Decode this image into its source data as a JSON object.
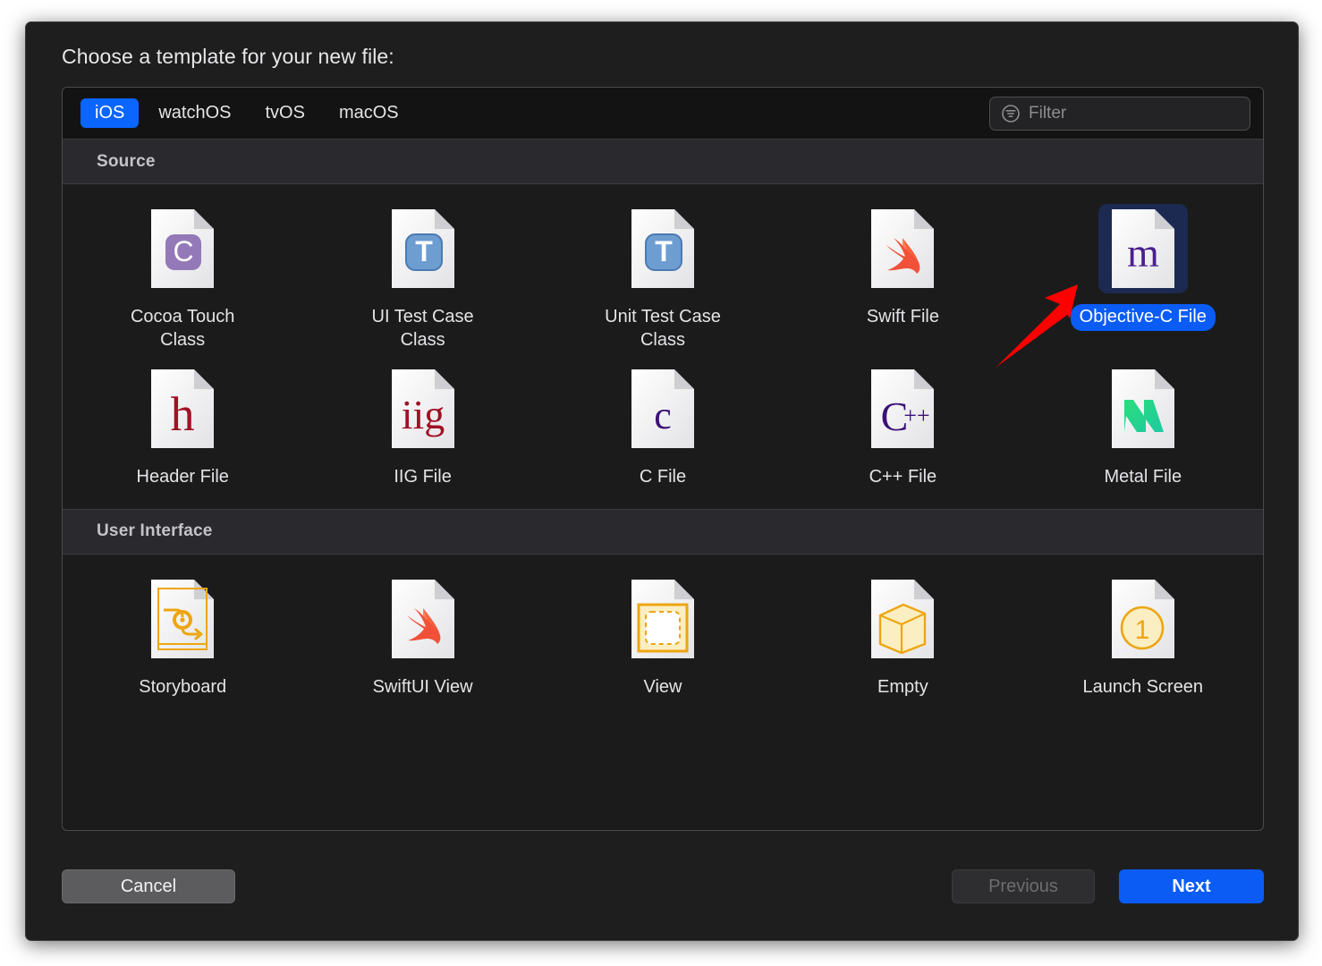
{
  "dialog": {
    "title": "Choose a template for your new file:"
  },
  "tabs": [
    {
      "label": "iOS",
      "active": true
    },
    {
      "label": "watchOS",
      "active": false
    },
    {
      "label": "tvOS",
      "active": false
    },
    {
      "label": "macOS",
      "active": false
    }
  ],
  "filter": {
    "placeholder": "Filter",
    "value": "",
    "icon": "filter-icon"
  },
  "sections": [
    {
      "header": "Source",
      "items": [
        {
          "label": "Cocoa Touch Class",
          "icon": "cocoa-touch-class-file-icon",
          "selected": false
        },
        {
          "label": "UI Test Case Class",
          "icon": "ui-test-case-class-file-icon",
          "selected": false
        },
        {
          "label": "Unit Test Case Class",
          "icon": "unit-test-case-class-file-icon",
          "selected": false
        },
        {
          "label": "Swift File",
          "icon": "swift-file-icon",
          "selected": false
        },
        {
          "label": "Objective-C File",
          "icon": "objective-c-file-icon",
          "selected": true
        },
        {
          "label": "Header File",
          "icon": "header-file-icon",
          "selected": false
        },
        {
          "label": "IIG File",
          "icon": "iig-file-icon",
          "selected": false
        },
        {
          "label": "C File",
          "icon": "c-file-icon",
          "selected": false
        },
        {
          "label": "C++ File",
          "icon": "cpp-file-icon",
          "selected": false
        },
        {
          "label": "Metal File",
          "icon": "metal-file-icon",
          "selected": false
        }
      ]
    },
    {
      "header": "User Interface",
      "items": [
        {
          "label": "Storyboard",
          "icon": "storyboard-file-icon",
          "selected": false
        },
        {
          "label": "SwiftUI View",
          "icon": "swiftui-view-file-icon",
          "selected": false
        },
        {
          "label": "View",
          "icon": "view-file-icon",
          "selected": false
        },
        {
          "label": "Empty",
          "icon": "empty-file-icon",
          "selected": false
        },
        {
          "label": "Launch Screen",
          "icon": "launch-screen-file-icon",
          "selected": false
        }
      ]
    }
  ],
  "buttons": {
    "cancel": "Cancel",
    "previous": "Previous",
    "next": "Next"
  },
  "annotation": {
    "type": "arrow",
    "color": "#ff0000",
    "points_to": "Objective-C File"
  },
  "colors": {
    "accent": "#0a5cf5",
    "tab_active": "#0a66ff",
    "selection_bg": "#1c2a52",
    "dialog_bg": "#1e1e1f",
    "panel_bg": "#1b1b1c",
    "section_header_bg": "#2a2a2e",
    "annotation": "#ff0000"
  }
}
